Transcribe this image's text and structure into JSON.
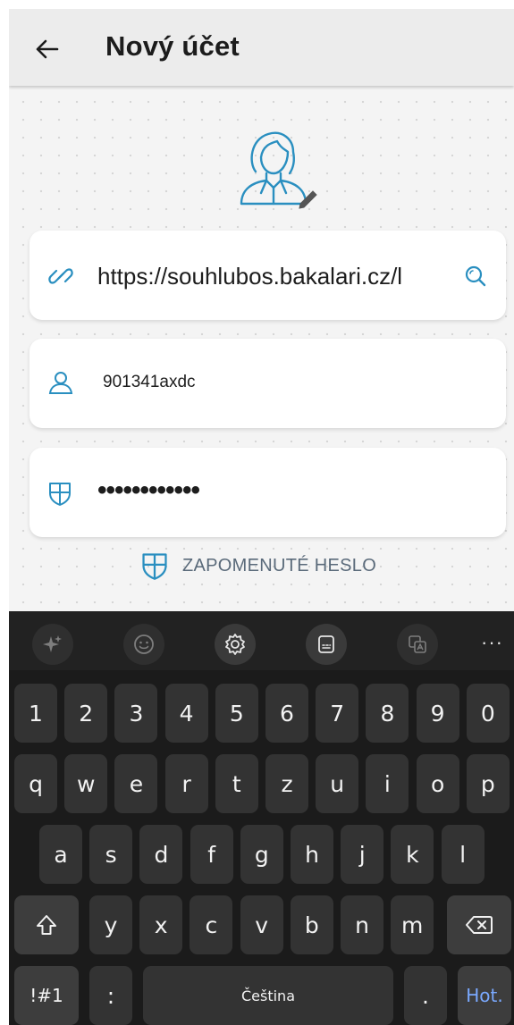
{
  "appbar": {
    "title": "Nový účet"
  },
  "form": {
    "server_url": "https://souhlubos.bakalari.cz/l",
    "username": "901341axdc",
    "password_mask": "••••••••••••",
    "forgot_label": "ZAPOMENUTÉ HESLO"
  },
  "keyboard": {
    "toolbar": [
      "sparkle-icon",
      "emoji-icon",
      "settings-icon",
      "clipboard-icon",
      "translate-icon",
      "more-icon"
    ],
    "more_label": "···",
    "row_numbers": [
      "1",
      "2",
      "3",
      "4",
      "5",
      "6",
      "7",
      "8",
      "9",
      "0"
    ],
    "row_top": [
      "q",
      "w",
      "e",
      "r",
      "t",
      "z",
      "u",
      "i",
      "o",
      "p"
    ],
    "row_mid": [
      "a",
      "s",
      "d",
      "f",
      "g",
      "h",
      "j",
      "k",
      "l"
    ],
    "row_bottom": [
      "y",
      "x",
      "c",
      "v",
      "b",
      "n",
      "m"
    ],
    "symbols_label": "!#1",
    "colon_label": ":",
    "space_label": "Čeština",
    "period_label": ".",
    "action_label": "Hot."
  },
  "colors": {
    "accent": "#2a8fc0",
    "keyboard_bg": "#1b1b1b",
    "key_bg": "#333333",
    "action": "#7aa9ff"
  }
}
